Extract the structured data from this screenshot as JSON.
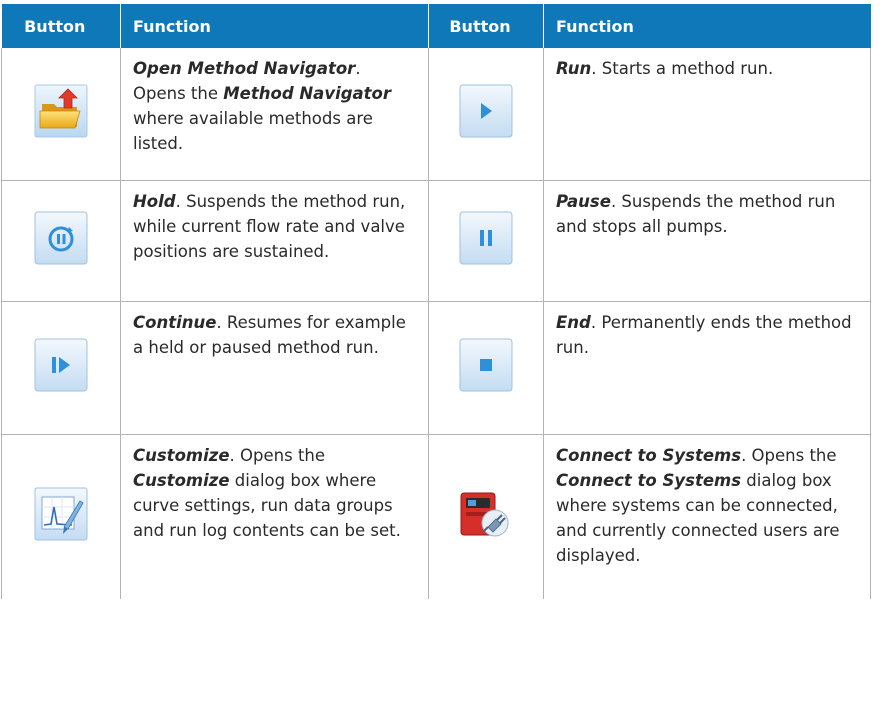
{
  "headers": {
    "button": "Button",
    "function": "Function",
    "button2": "Button",
    "function2": "Function"
  },
  "rows": [
    {
      "left": {
        "icon": "open-folder-icon",
        "term": "Open Method Navigator",
        "pre": ". Opens the ",
        "term2": "Method Navigator",
        "post": " where available methods are listed."
      },
      "right": {
        "icon": "play-icon",
        "term": "Run",
        "post": ". Starts a method run."
      }
    },
    {
      "left": {
        "icon": "hold-icon",
        "term": "Hold",
        "post": ". Suspends the method run, while current flow rate and valve positions are sustained."
      },
      "right": {
        "icon": "pause-icon",
        "term": "Pause",
        "post": ". Suspends the method run and stops all pumps."
      }
    },
    {
      "left": {
        "icon": "continue-icon",
        "term": "Continue",
        "post": ". Resumes for example a held or paused method run."
      },
      "right": {
        "icon": "stop-icon",
        "term": "End",
        "post": ". Permanently ends the method run."
      }
    },
    {
      "left": {
        "icon": "customize-curve-icon",
        "term": "Customize",
        "pre": ". Opens the ",
        "term2": "Customize",
        "post": " dialog box where curve settings, run data groups and run log contents can be set."
      },
      "right": {
        "icon": "connect-systems-icon",
        "term": "Connect to Systems",
        "pre": ". Opens the ",
        "term2": "Connect to Systems",
        "post": " dialog box where systems can be connected, and currently connected users are displayed."
      }
    }
  ],
  "colors": {
    "header_bg": "#0e78b8",
    "header_text": "#ffffff",
    "border": "#b3b3b3",
    "icon_blue": "#2f8fd8"
  }
}
